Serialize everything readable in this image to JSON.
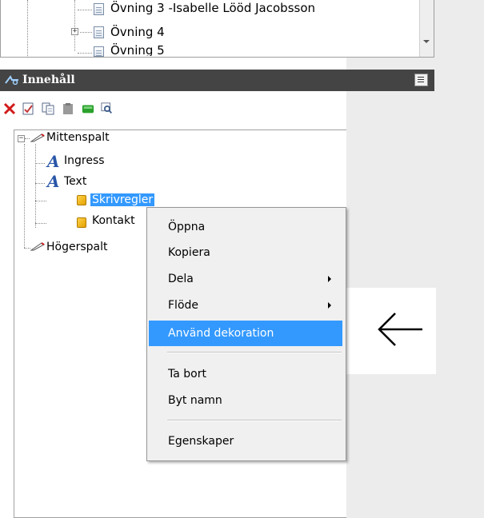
{
  "top_tree": {
    "items": [
      {
        "label": "Övning 3 -Isabelle Lööd Jacobsson"
      },
      {
        "label": "Övning 4"
      },
      {
        "label": "Övning 5"
      }
    ]
  },
  "panel": {
    "title": "Innehåll"
  },
  "toolbar": {
    "icons": [
      "delete-icon",
      "edit-icon",
      "copy-icon",
      "paste-icon",
      "book-icon",
      "preview-icon"
    ]
  },
  "tree": {
    "mittenspalt": "Mittenspalt",
    "ingress": "Ingress",
    "text": "Text",
    "skrivregler": "Skrivregler",
    "kontakt": "Kontakt",
    "hogerspalt": "Högerspalt"
  },
  "context_menu": {
    "items": [
      {
        "label": "Öppna"
      },
      {
        "label": "Kopiera"
      },
      {
        "label": "Dela"
      },
      {
        "label": "Flöde"
      },
      {
        "label": "Använd dekoration"
      },
      {
        "label": "Ta bort"
      },
      {
        "label": "Byt namn"
      },
      {
        "label": "Egenskaper"
      }
    ]
  },
  "annotation": {
    "arrow": "left-arrow-icon"
  },
  "colors": {
    "highlight": "#3399ff",
    "header_bg": "#444444",
    "delete_red": "#d21a1a"
  }
}
